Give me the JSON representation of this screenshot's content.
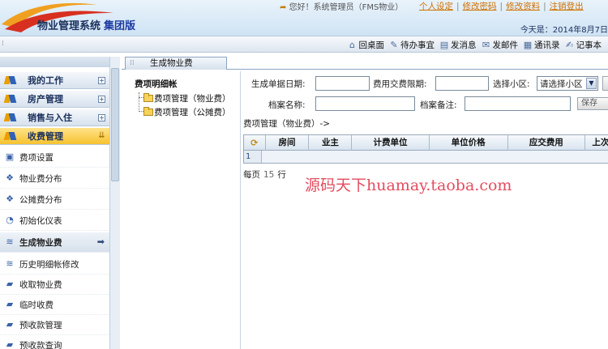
{
  "header": {
    "system_title": "物业管理系统",
    "edition": "集团版",
    "greeting": "您好！系统管理员（FMS物业）",
    "links": [
      "个人设定",
      "修改密码",
      "修改资料",
      "注销登出"
    ],
    "date_text": "今天是：2014年8月7日"
  },
  "toolbar": {
    "items": [
      {
        "label": "回桌面",
        "icon": "home-icon"
      },
      {
        "label": "待办事宜",
        "icon": "todo-icon"
      },
      {
        "label": "发消息",
        "icon": "message-icon"
      },
      {
        "label": "发邮件",
        "icon": "mail-icon"
      },
      {
        "label": "通讯录",
        "icon": "contacts-icon"
      },
      {
        "label": "记事本",
        "icon": "notebook-icon"
      }
    ]
  },
  "sidebar": {
    "categories": [
      {
        "label": "我的工作",
        "toggle": "+"
      },
      {
        "label": "房产管理",
        "toggle": "+"
      },
      {
        "label": "销售与入住",
        "toggle": "+"
      },
      {
        "label": "收费管理",
        "toggle": "⇊"
      }
    ],
    "items": [
      {
        "label": "费项设置",
        "icon": "settings-doc-icon"
      },
      {
        "label": "物业费分布",
        "icon": "distribution-icon"
      },
      {
        "label": "公摊费分布",
        "icon": "distribution-icon"
      },
      {
        "label": "初始化仪表",
        "icon": "meter-icon"
      },
      {
        "label": "生成物业费",
        "icon": "generate-icon"
      },
      {
        "label": "历史明细帐修改",
        "icon": "history-edit-icon"
      },
      {
        "label": "收取物业费",
        "icon": "collect-fee-icon"
      },
      {
        "label": "临时收费",
        "icon": "temp-charge-icon"
      },
      {
        "label": "预收款管理",
        "icon": "prepay-icon"
      },
      {
        "label": "预收款查询",
        "icon": "prepay-query-icon"
      }
    ]
  },
  "tab": {
    "label": "生成物业费"
  },
  "tree": {
    "root": "费项明细帐",
    "nodes": [
      "费项管理（物业费）",
      "费项管理（公摊费）"
    ]
  },
  "form": {
    "gen_date_label": "生成单据日期:",
    "gen_date_value": "",
    "fee_period_label": "费用交费限期:",
    "fee_period_value": "",
    "district_label": "选择小区:",
    "district_value": "请选择小区",
    "archive_name_label": "档案名称:",
    "archive_name_value": "",
    "archive_note_label": "档案备注:",
    "archive_note_value": "",
    "save_label": "保存"
  },
  "breadcrumb": "费项管理（物业费）->",
  "grid": {
    "columns": [
      "房间",
      "业主",
      "计费单位",
      "单位价格",
      "应交费用",
      "上次"
    ],
    "rows": [
      {
        "row_number": "1"
      }
    ]
  },
  "pager": {
    "prefix": "每页",
    "count": "15",
    "suffix": "行"
  },
  "watermark": "源码天下huamay.taoba.com",
  "colors": {
    "accent_orange": "#d07000",
    "header_navy": "#1a2f5c",
    "watermark_red": "#e0344a"
  }
}
